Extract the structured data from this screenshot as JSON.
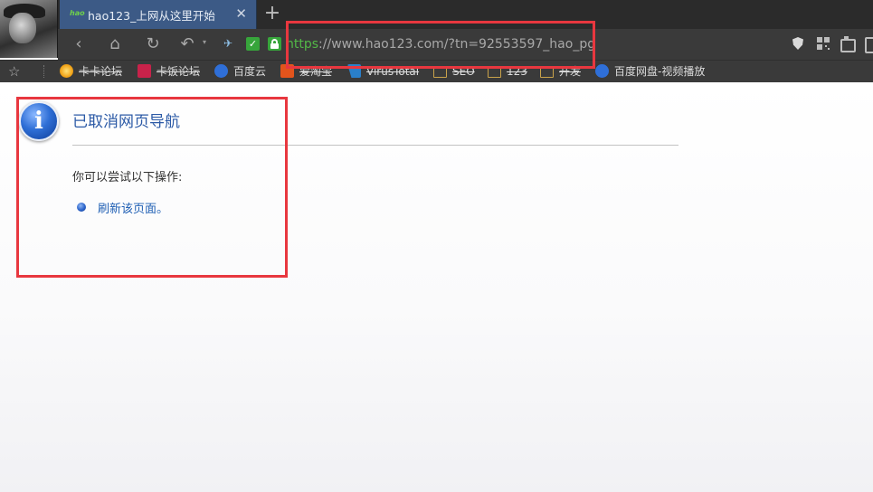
{
  "tab": {
    "favicon_text": "hao",
    "title": "hao123_上网从这里开始",
    "close_glyph": "✕",
    "new_tab_glyph": "+"
  },
  "toolbar": {
    "back_glyph": "‹",
    "home_glyph": "⌂",
    "reload_glyph": "↻",
    "undo_glyph": "↶",
    "dropdown_glyph": "▾",
    "ext_check_glyph": "✓",
    "url_scheme": "https",
    "url_rest": "://www.hao123.com/?tn=92553597_hao_pg",
    "right_icons": [
      "shield-icon",
      "qr-code-icon",
      "screenshot-icon",
      "menu-icon"
    ]
  },
  "bookmarks": {
    "star_glyph": "☆",
    "items": [
      {
        "label": "卡卡论坛",
        "icon": "kaka-icon"
      },
      {
        "label": "卡饭论坛",
        "icon": "kafan-icon"
      },
      {
        "label": "百度云",
        "icon": "baidu-cloud-icon"
      },
      {
        "label": "爱淘宝",
        "icon": "taobao-icon"
      },
      {
        "label": "VirusTotal",
        "icon": "virustotal-icon"
      },
      {
        "label": "SEO",
        "icon": "folder-icon"
      },
      {
        "label": "123",
        "icon": "folder-icon"
      },
      {
        "label": "开发",
        "icon": "folder-icon"
      },
      {
        "label": "百度网盘-视频播放",
        "icon": "baidu-cloud-icon"
      }
    ]
  },
  "page": {
    "info_glyph": "i",
    "title": "已取消网页导航",
    "suggest_label": "你可以尝试以下操作:",
    "refresh_link": "刷新该页面。"
  },
  "colors": {
    "annotation_red": "#e8373f",
    "link_blue": "#1f5fb4",
    "title_blue": "#2c5aa6",
    "secure_green": "#53b847",
    "tab_blue": "#3c5a86"
  }
}
